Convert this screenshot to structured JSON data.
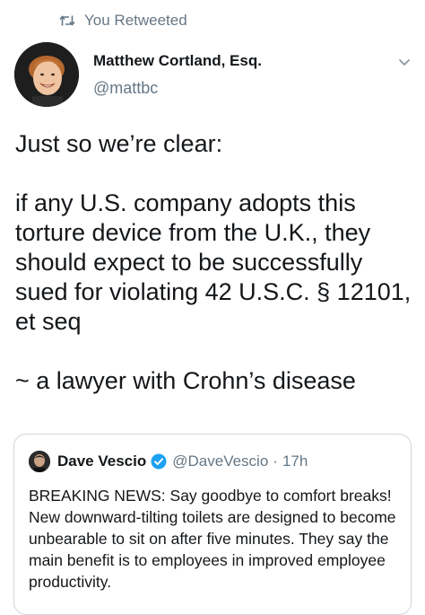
{
  "social_context": {
    "icon": "retweet-icon",
    "text": "You Retweeted"
  },
  "author": {
    "name": "Matthew Cortland, Esq.",
    "handle": "@mattbc"
  },
  "tweet": {
    "line1": "Just so we’re clear:",
    "line2": "if any U.S. company adopts this torture device from the U.K., they should expect to be successfully sued for violating 42 U.S.C. § 12101, et seq",
    "line3": "~ a lawyer with Crohn’s disease"
  },
  "quoted": {
    "name": "Dave Vescio",
    "handle": "@DaveVescio",
    "separator": "·",
    "time": "17h",
    "text": "BREAKING NEWS: Say goodbye to comfort breaks! New downward-tilting toilets are designed to become unbearable to sit on after five minutes. They say the main benefit is to employees in improved employee productivity."
  },
  "colors": {
    "text_primary": "#14171a",
    "text_secondary": "#657786",
    "border": "#ccd6dd",
    "verified": "#1da1f2"
  },
  "icons": [
    "retweet-icon",
    "chevron-down-icon",
    "verified-badge-icon"
  ]
}
